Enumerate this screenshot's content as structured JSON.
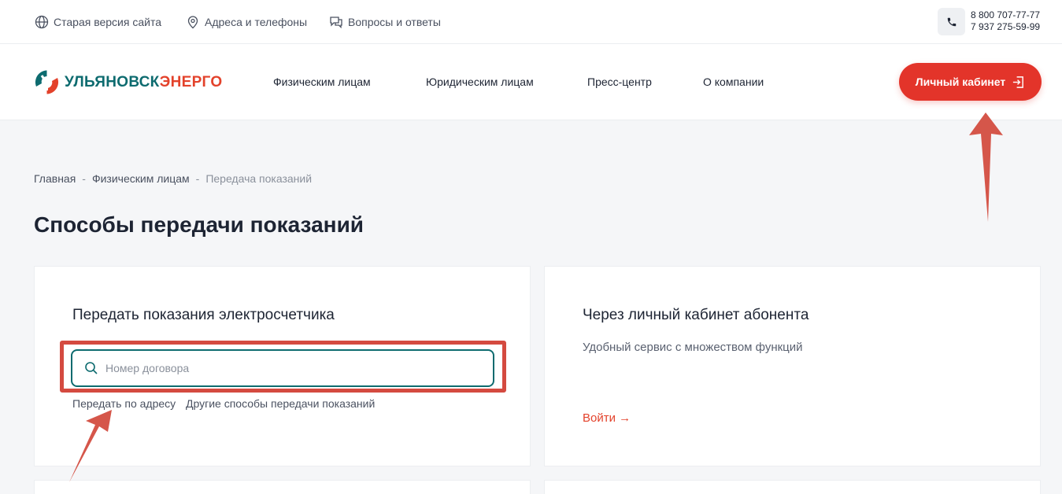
{
  "topbar": {
    "old_site": "Старая версия сайта",
    "addresses": "Адреса и телефоны",
    "faq": "Вопросы и ответы",
    "phone1": "8 800 707-77-77",
    "phone2": "7 937 275-59-99"
  },
  "header": {
    "logo_part1": "УЛЬЯНОВСК",
    "logo_part2": "ЭНЕРГО",
    "nav": [
      "Физическим лицам",
      "Юридическим лицам",
      "Пресс-центр",
      "О компании"
    ],
    "cabinet_button": "Личный кабинет"
  },
  "breadcrumb": {
    "home": "Главная",
    "sep": "-",
    "section": "Физическим лицам",
    "current": "Передача показаний"
  },
  "page_title": "Способы передачи показаний",
  "card_meter": {
    "title": "Передать показания электросчетчика",
    "search_placeholder": "Номер договора",
    "link_address": "Передать по адресу",
    "link_other": "Другие способы передачи показаний"
  },
  "card_cabinet": {
    "title": "Через личный кабинет абонента",
    "description": "Удобный сервис с множеством функций",
    "login": "Войти →"
  },
  "colors": {
    "brand_red": "#e3342a",
    "brand_teal": "#0d6b6f",
    "annotation_red": "#d44a40"
  }
}
